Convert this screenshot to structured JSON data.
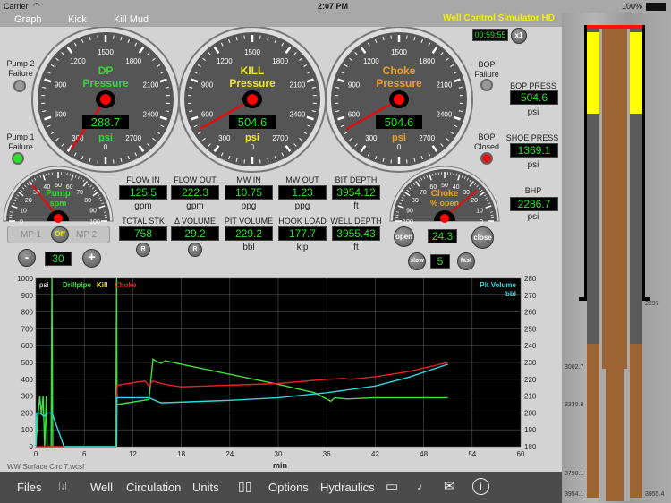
{
  "status": {
    "carrier": "Carrier",
    "time": "2:07 PM",
    "battery": "100%"
  },
  "menu": {
    "graph": "Graph",
    "kick": "Kick",
    "kill_mud": "Kill Mud",
    "title": "Well Control Simulator HD"
  },
  "timer": {
    "value": "00:59:55",
    "speed": "x1"
  },
  "gauges": {
    "ticks": [
      "0",
      "300",
      "600",
      "900",
      "1200",
      "1500",
      "1800",
      "2100",
      "2400",
      "2700"
    ],
    "dp": {
      "title1": "DP",
      "title2": "Pressure",
      "value": "288.7",
      "unit": "psi",
      "color": "#2fdc2f",
      "reading": 288.7
    },
    "kill": {
      "title1": "KILL",
      "title2": "Pressure",
      "value": "504.6",
      "unit": "psi",
      "color": "#f0e81e",
      "reading": 504.6
    },
    "choke": {
      "title1": "Choke",
      "title2": "Pressure",
      "value": "504.6",
      "unit": "psi",
      "color": "#f0a020",
      "reading": 504.6
    }
  },
  "pump_gauge": {
    "title1": "Pump",
    "title2": "spm",
    "ticks": [
      "0",
      "10",
      "20",
      "30",
      "40",
      "50",
      "60",
      "70",
      "80",
      "90",
      "100"
    ],
    "reading": 30
  },
  "choke_gauge": {
    "title1": "Choke",
    "title2": "% open",
    "ticks": [
      "100",
      "90",
      "80",
      "70",
      "60",
      "50",
      "40",
      "30",
      "20",
      "10",
      "0"
    ],
    "reading": 24.3
  },
  "indicators": {
    "pump2": "Pump 2\nFailure",
    "pump1": "Pump 1\nFailure",
    "bop_failure": "BOP\nFailure",
    "bop_closed": "BOP\nClosed",
    "pump1_color": "#2ee02e",
    "bop_closed_color": "#e01010"
  },
  "side": {
    "bop_press": {
      "label": "BOP PRESS",
      "value": "504.6",
      "unit": "psi"
    },
    "shoe_press": {
      "label": "SHOE PRESS",
      "value": "1369.1",
      "unit": "psi"
    },
    "bhp": {
      "label": "BHP",
      "value": "2286.7",
      "unit": "psi"
    }
  },
  "readouts": [
    {
      "label": "FLOW IN",
      "value": "125.5",
      "unit": "gpm"
    },
    {
      "label": "FLOW OUT",
      "value": "222.3",
      "unit": "gpm"
    },
    {
      "label": "MW IN",
      "value": "10.75",
      "unit": "ppg"
    },
    {
      "label": "MW OUT",
      "value": "1.23",
      "unit": "ppg"
    },
    {
      "label": "BIT DEPTH",
      "value": "3954.12",
      "unit": "ft"
    },
    {
      "label": "TOTAL STK",
      "value": "758",
      "unit": "",
      "reset": "R"
    },
    {
      "label": "Δ VOLUME",
      "value": "29.2",
      "unit": "",
      "reset": "R"
    },
    {
      "label": "PIT VOLUME",
      "value": "229.2",
      "unit": "bbl"
    },
    {
      "label": "HOOK LOAD",
      "value": "177.7",
      "unit": "kip"
    },
    {
      "label": "WELL DEPTH",
      "value": "3955.43",
      "unit": "ft"
    }
  ],
  "pump_ctrl": {
    "mp1": "MP 1",
    "off": "Off",
    "mp2": "MP 2",
    "minus": "-",
    "spm": "30",
    "plus": "+"
  },
  "choke_ctrl": {
    "open": "open",
    "value": "24.3",
    "close": "close",
    "slow": "slow",
    "rate": "5",
    "fast": "fast"
  },
  "chart_data": {
    "type": "line",
    "xlabel": "min",
    "ylabel_left": "psi",
    "ylabel_right": "Pit Volume",
    "right_unit": "bbl",
    "xlim": [
      0,
      60
    ],
    "ylim_left": [
      0,
      1000
    ],
    "ylim_right": [
      180,
      280
    ],
    "xticks": [
      "0",
      "6",
      "12",
      "18",
      "24",
      "30",
      "36",
      "42",
      "48",
      "54",
      "60"
    ],
    "yticks_left": [
      "0",
      "100",
      "200",
      "300",
      "400",
      "500",
      "600",
      "700",
      "800",
      "900",
      "1000"
    ],
    "yticks_right": [
      "180",
      "190",
      "200",
      "210",
      "220",
      "230",
      "240",
      "250",
      "260",
      "270",
      "280"
    ],
    "grid": true,
    "filename": "WW Surface Circ 7.wcsf",
    "series": [
      {
        "name": "Drillpipe",
        "axis": "left",
        "color": "#3ee03e",
        "points": [
          [
            0,
            0
          ],
          [
            0.3,
            200
          ],
          [
            0.5,
            300
          ],
          [
            0.7,
            190
          ],
          [
            0.9,
            300
          ],
          [
            1.1,
            0
          ],
          [
            1.3,
            300
          ],
          [
            1.4,
            0
          ],
          [
            1.9,
            0
          ],
          [
            2.0,
            1000
          ],
          [
            2.1,
            0
          ],
          [
            9.9,
            0
          ],
          [
            10,
            1000
          ],
          [
            10.05,
            250
          ],
          [
            14,
            280
          ],
          [
            14.5,
            520
          ],
          [
            15,
            505
          ],
          [
            15.5,
            495
          ],
          [
            16,
            510
          ],
          [
            17,
            500
          ],
          [
            18,
            490
          ],
          [
            30,
            370
          ],
          [
            34.5,
            320
          ],
          [
            36.5,
            270
          ],
          [
            37,
            290
          ],
          [
            38.5,
            283
          ],
          [
            42,
            290
          ],
          [
            51,
            290
          ]
        ]
      },
      {
        "name": "Kill",
        "axis": "left",
        "color": "#f0e81e",
        "points": []
      },
      {
        "name": "Choke",
        "axis": "left",
        "color": "#e82020",
        "points": [
          [
            0,
            0
          ],
          [
            10,
            0
          ],
          [
            10,
            300
          ],
          [
            10.1,
            365
          ],
          [
            13.5,
            390
          ],
          [
            14,
            360
          ],
          [
            14.5,
            390
          ],
          [
            16,
            370
          ],
          [
            18,
            355
          ],
          [
            24,
            365
          ],
          [
            30,
            375
          ],
          [
            36,
            400
          ],
          [
            38,
            405
          ],
          [
            39,
            400
          ],
          [
            42,
            415
          ],
          [
            46,
            445
          ],
          [
            51,
            500
          ]
        ]
      },
      {
        "name": "Pit Volume",
        "axis": "right",
        "color": "#2cd8e0",
        "points": [
          [
            0,
            180
          ],
          [
            0.1,
            200
          ],
          [
            0.5,
            200
          ],
          [
            1,
            198
          ],
          [
            1.5,
            200
          ],
          [
            2,
            200
          ],
          [
            3.5,
            180
          ],
          [
            10,
            180
          ],
          [
            10.05,
            209
          ],
          [
            14,
            209
          ],
          [
            15.5,
            206
          ],
          [
            24,
            207.5
          ],
          [
            30,
            209
          ],
          [
            36,
            212
          ],
          [
            42,
            216
          ],
          [
            46,
            221
          ],
          [
            51,
            229
          ]
        ]
      }
    ]
  },
  "toolbar": {
    "files": "Files",
    "well": "Well",
    "circulation": "Circulation",
    "units": "Units",
    "options": "Options",
    "hydraulics": "Hydraulics"
  },
  "well": {
    "shoe": "2297",
    "d1": "3002.7",
    "d2": "3330.8",
    "d3": "3790.1",
    "d4": "3954.1",
    "td": "3955.4"
  }
}
